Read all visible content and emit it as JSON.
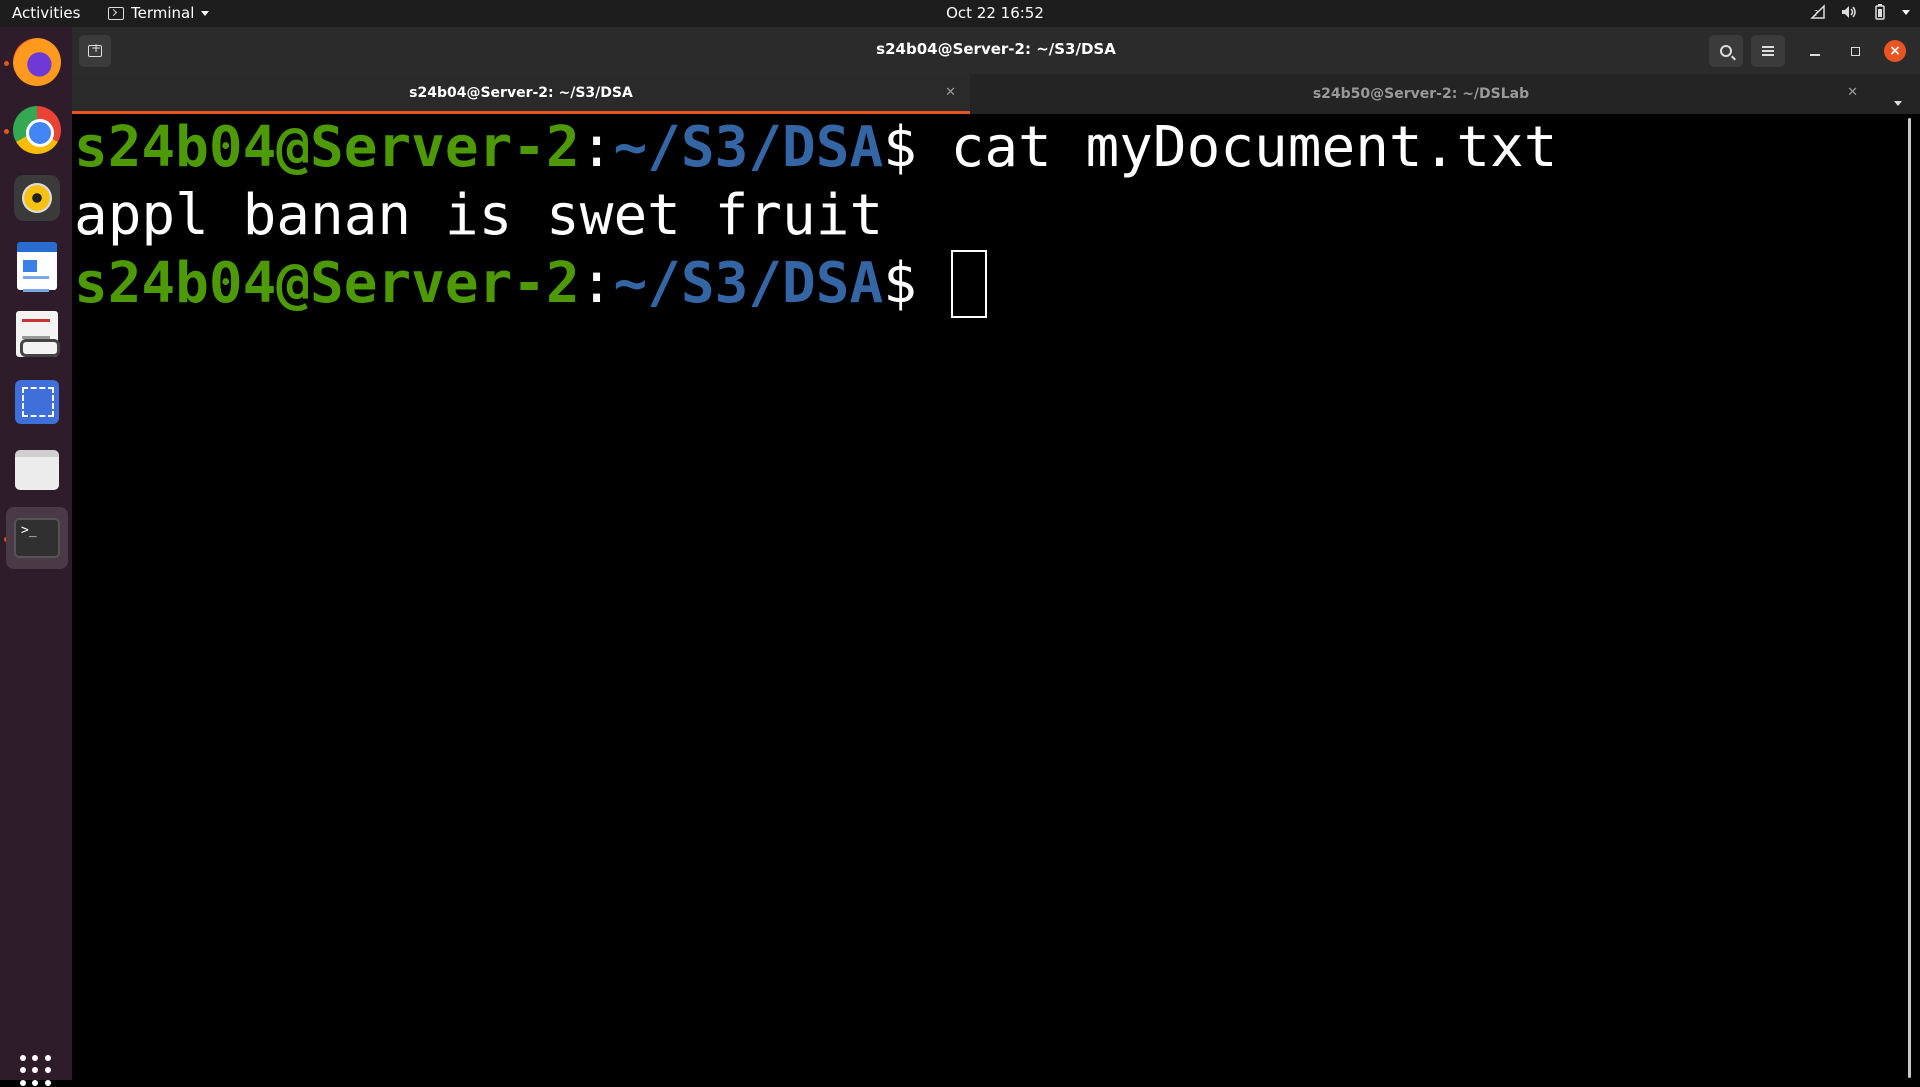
{
  "topbar": {
    "activities": "Activities",
    "app_name": "Terminal",
    "clock": "Oct 22  16:52"
  },
  "dock": {
    "items": [
      "firefox-icon",
      "chrome-icon",
      "rhythmbox-icon",
      "libreoffice-writer-icon",
      "document-viewer-icon",
      "screenshot-icon",
      "files-icon",
      "terminal-icon"
    ],
    "terminal_glyph": ">_"
  },
  "window": {
    "title": "s24b04@Server-2: ~/S3/DSA"
  },
  "tabs": [
    {
      "label": "s24b04@Server-2: ~/S3/DSA",
      "active": true
    },
    {
      "label": "s24b50@Server-2: ~/DSLab",
      "active": false
    }
  ],
  "terminal": {
    "lines": [
      {
        "user": "s24b04@Server-2",
        "sep": ":",
        "path": "~/S3/DSA",
        "prompt": "$ ",
        "command": "cat myDocument.txt"
      },
      {
        "output": "appl banan is swet fruit"
      },
      {
        "user": "s24b04@Server-2",
        "sep": ":",
        "path": "~/S3/DSA",
        "prompt": "$ ",
        "command": ""
      }
    ]
  },
  "colors": {
    "accent": "#e95420",
    "prompt_user": "#4e9a06",
    "prompt_path": "#3465a4",
    "background": "#000000"
  }
}
